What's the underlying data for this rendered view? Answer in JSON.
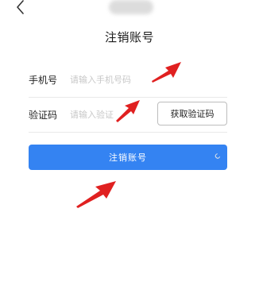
{
  "nav": {
    "back_icon": "chevron-left-icon"
  },
  "page": {
    "title": "注销账号"
  },
  "form": {
    "phone": {
      "label": "手机号",
      "placeholder": "请输入手机号码",
      "value": ""
    },
    "code": {
      "label": "验证码",
      "placeholder": "请输入验证",
      "value": "",
      "get_code_label": "获取验证码"
    },
    "submit_label": "注销账号"
  },
  "colors": {
    "primary": "#3483f2",
    "annotation_arrow": "#e02020"
  },
  "annotations": {
    "arrow_icon": "red-pointer-arrow-icon"
  }
}
